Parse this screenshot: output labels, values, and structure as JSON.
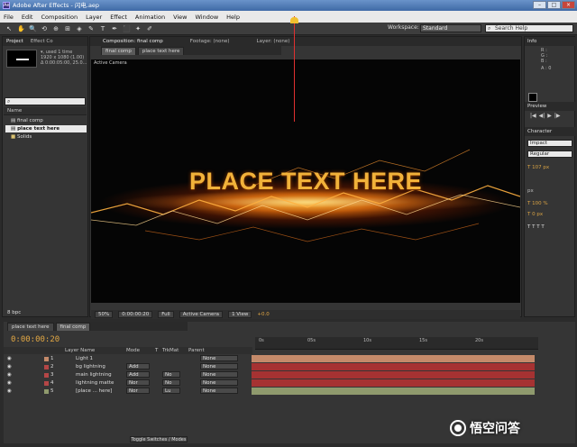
{
  "window": {
    "title": "Adobe After Effects - 闪电.aep",
    "app_icon": "Ae",
    "min": "–",
    "max": "□",
    "close": "×"
  },
  "menu": [
    "File",
    "Edit",
    "Composition",
    "Layer",
    "Effect",
    "Animation",
    "View",
    "Window",
    "Help"
  ],
  "toolbar": {
    "tools": [
      "↖",
      "✋",
      "🔍",
      "⟲",
      "⊕",
      "⊞",
      "◈",
      "✎",
      "T",
      "✒",
      "⬛",
      "✦",
      "✐"
    ],
    "workspace_label": "Workspace:",
    "workspace_value": "Standard",
    "search_placeholder": "Search Help"
  },
  "project_panel": {
    "tabs": [
      "Project",
      "Effect Co"
    ],
    "thumb_info": [
      "▾, used 1 time",
      "1920 x 1080 (1.00)",
      "Δ 0:00:05:00, 25.0..."
    ],
    "columns": [
      "Name"
    ],
    "items": [
      {
        "label": "final comp",
        "selected": false
      },
      {
        "label": "place text here",
        "selected": true
      },
      {
        "label": "Solids",
        "selected": false
      }
    ],
    "footer": "8 bpc"
  },
  "composition_panel": {
    "tabs": [
      "Composition: final comp",
      "Footage: (none)",
      "Layer: (none)"
    ],
    "subtabs": [
      "final comp",
      "place text here"
    ],
    "camera_label": "Active Camera",
    "overlay_text": "PLACE TEXT HERE",
    "viewbar": {
      "zoom": "50%",
      "timecode": "0:00:00:20",
      "resolution": "Full",
      "camera": "Active Camera",
      "views": "1 View",
      "exposure": "+0.0"
    }
  },
  "right_panels": {
    "info_title": "Info",
    "info_labels": [
      "R :",
      "G :",
      "B :",
      "A : 0"
    ],
    "preview_title": "Preview",
    "preview_buttons": [
      "|◀",
      "◀|",
      "▶",
      "|▶",
      "▶|",
      "◀)"
    ],
    "character_title": "Character",
    "font": "Impact",
    "style": "Regular",
    "char_rows": [
      "T 107 px",
      "px",
      "T 100 %",
      "T 0 px",
      "T T T T"
    ]
  },
  "timeline": {
    "tabs": [
      "place text here",
      "final comp"
    ],
    "timecode": "0:00:00:20",
    "columns": [
      "Layer Name",
      "Mode",
      "T",
      "TrkMat",
      "Parent"
    ],
    "layers": [
      {
        "num": "1",
        "name": "Light 1",
        "mode": "",
        "trk": "",
        "parent": "None",
        "color": "#c48a6a"
      },
      {
        "num": "2",
        "name": "bg lightning",
        "mode": "Add",
        "trk": "",
        "parent": "None",
        "color": "#b54646"
      },
      {
        "num": "3",
        "name": "main lightning",
        "mode": "Add",
        "trk": "No",
        "parent": "None",
        "color": "#b54646"
      },
      {
        "num": "4",
        "name": "lightning matte",
        "mode": "Nor",
        "trk": "No",
        "parent": "None",
        "color": "#b54646"
      },
      {
        "num": "5",
        "name": "[place ... here]",
        "mode": "Nor",
        "trk": "Lu",
        "parent": "None",
        "color": "#8f9a6d"
      }
    ],
    "ruler_ticks": [
      "0s",
      "05s",
      "10s",
      "15s",
      "20s"
    ],
    "toggle_label": "Toggle Switches / Modes"
  },
  "watermark": "悟空问答",
  "colors": {
    "lightning_bar": "#a63232",
    "accent_timecode": "#e3a844"
  }
}
